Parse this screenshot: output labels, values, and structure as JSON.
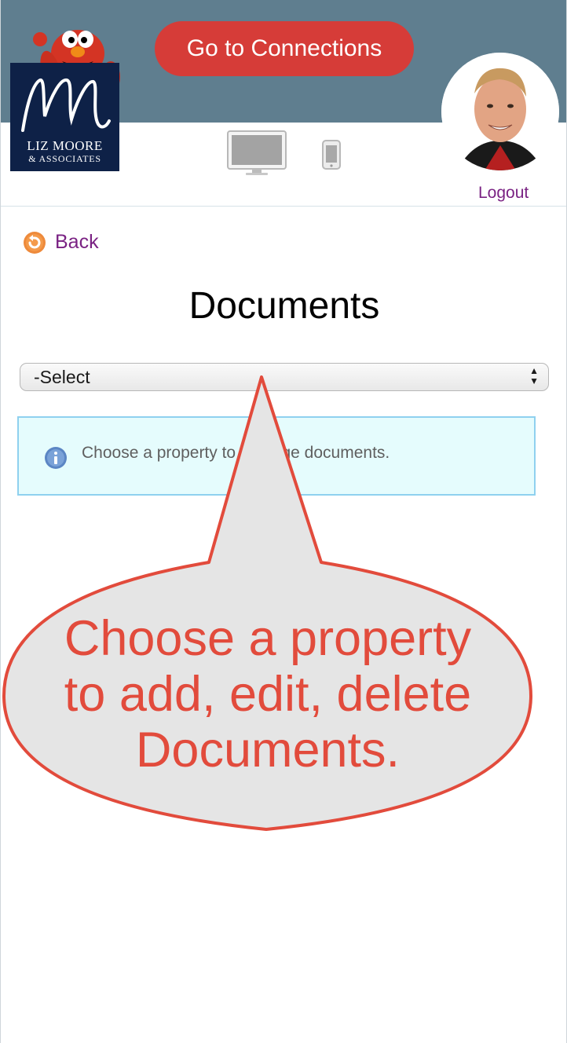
{
  "header": {
    "connections_button": "Go to Connections",
    "logo": {
      "name": "LIZ MOORE",
      "sub": "& ASSOCIATES"
    },
    "logout": "Logout",
    "icons": {
      "desktop": "desktop-monitor-icon",
      "mobile": "mobile-phone-icon"
    }
  },
  "nav": {
    "back_label": "Back"
  },
  "main": {
    "title": "Documents",
    "property_select": {
      "selected": "-Select"
    },
    "info_message": "Choose a property to manage documents."
  },
  "callout": {
    "lines": [
      "Choose a property",
      "to add, edit, delete",
      "Documents."
    ]
  },
  "colors": {
    "header_band": "#5f7e8f",
    "button_red": "#d63c38",
    "link_purple": "#7a2283",
    "callout_red": "#e24b3c",
    "info_bg": "#e5fcfd"
  }
}
